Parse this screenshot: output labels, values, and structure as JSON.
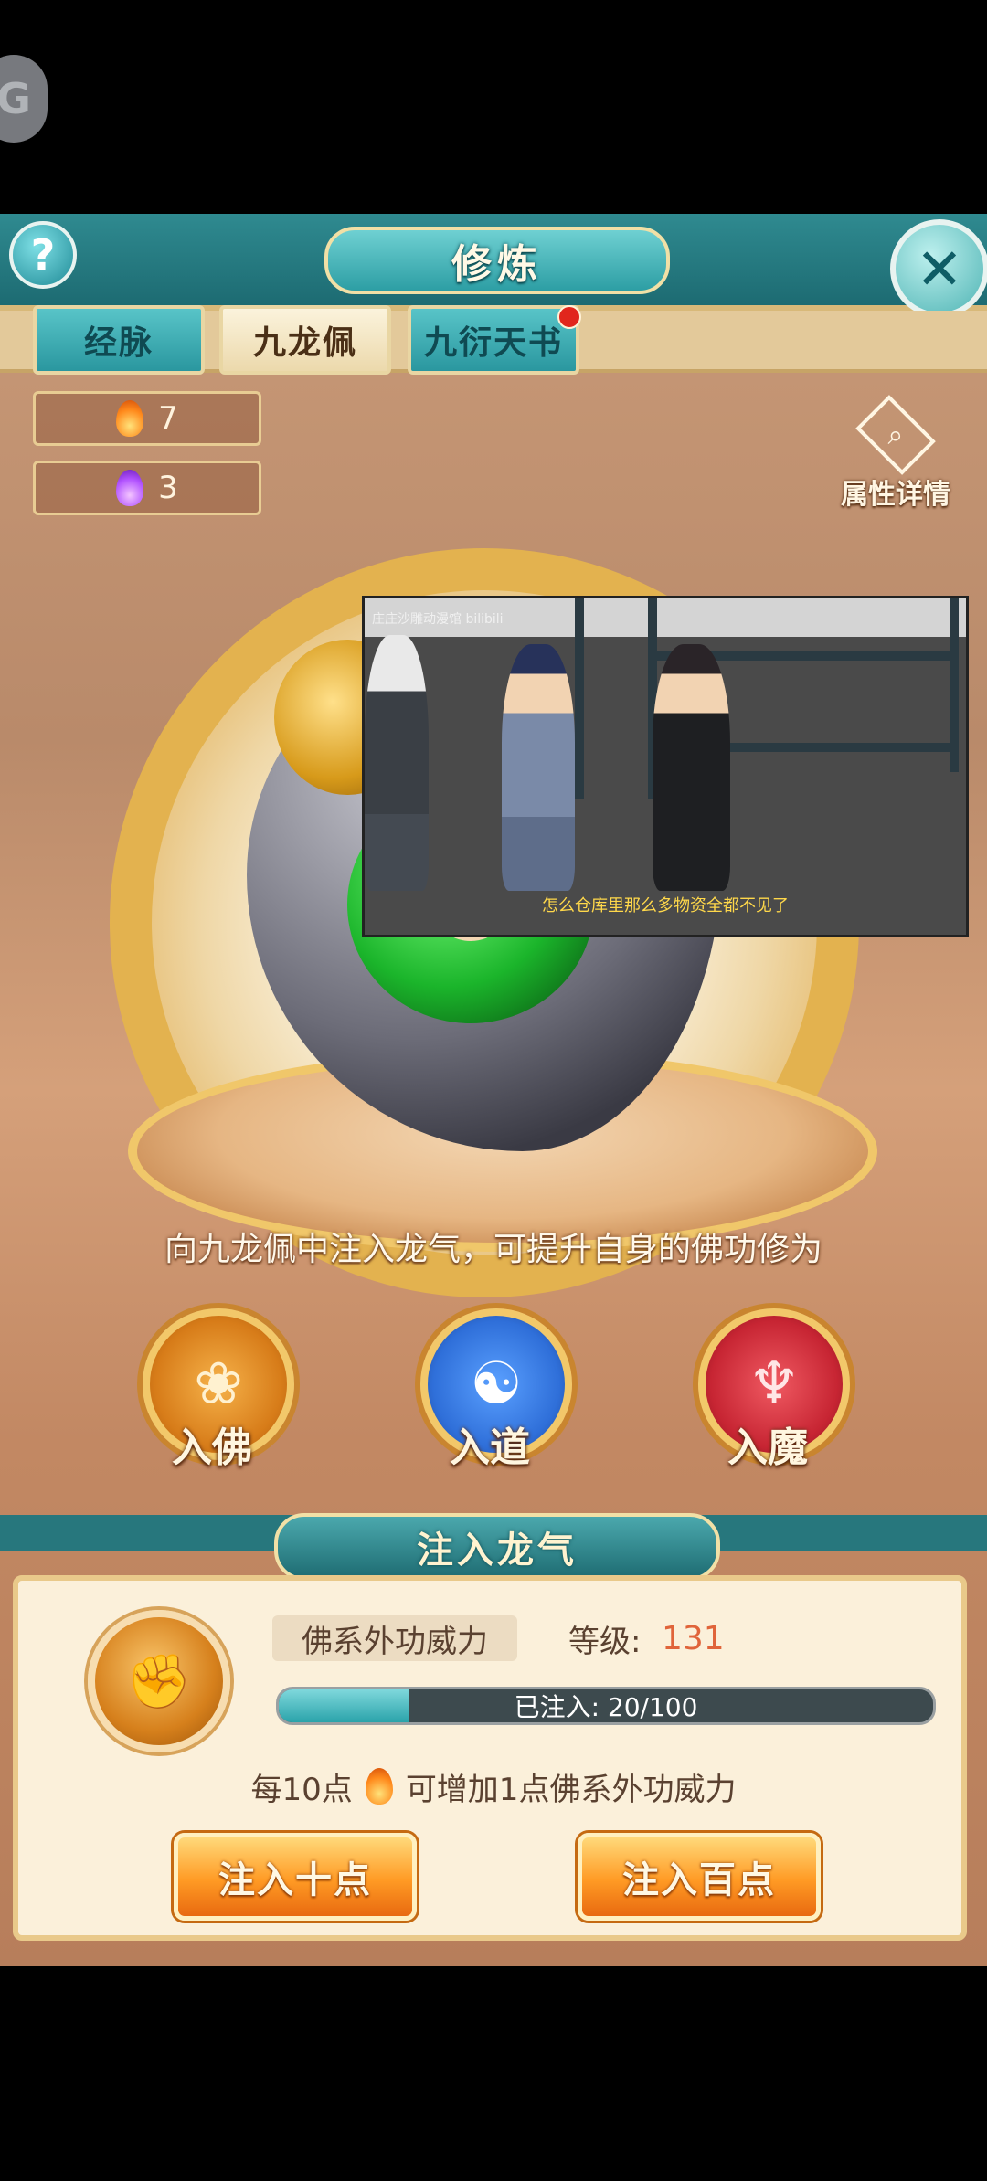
{
  "window": {
    "title": "修炼"
  },
  "floating_button": {
    "label": "G"
  },
  "tabs": [
    {
      "label": "经脉",
      "active": false
    },
    {
      "label": "九龙佩",
      "active": true
    },
    {
      "label": "九衍天书",
      "active": false,
      "badge": "red-dot"
    }
  ],
  "resources": [
    {
      "icon": "fire-icon",
      "color": "#ff8a1c",
      "count": "7"
    },
    {
      "icon": "purple-flame-icon",
      "color": "#b253ff",
      "count": "3"
    }
  ],
  "attribute_details": {
    "label": "属性详情",
    "icon": "magnifier-icon"
  },
  "video_overlay": {
    "watermark": "庄庄沙雕动漫馆 bilibili",
    "subtitle": "怎么仓库里那么多物资全都不见了"
  },
  "description": "向九龙佩中注入龙气，可提升自身的佛功修为",
  "paths": [
    {
      "label": "入佛",
      "icon": "lotus-icon",
      "color": "#e7962c"
    },
    {
      "label": "入道",
      "icon": "yin-yang-icon",
      "color": "#2f6fd9"
    },
    {
      "label": "入魔",
      "icon": "demon-icon",
      "color": "#c72533"
    }
  ],
  "inject": {
    "title": "注入龙气",
    "skill_name": "佛系外功威力",
    "level_label": "等级:",
    "level_value": "131",
    "progress_text": "已注入: 20/100",
    "progress_fraction": 0.2,
    "rate_prefix": "每10点",
    "rate_suffix": "可增加1点佛系外功威力",
    "buttons": [
      "注入十点",
      "注入百点"
    ]
  },
  "help_icon": "question-icon",
  "close_icon": "close-icon"
}
